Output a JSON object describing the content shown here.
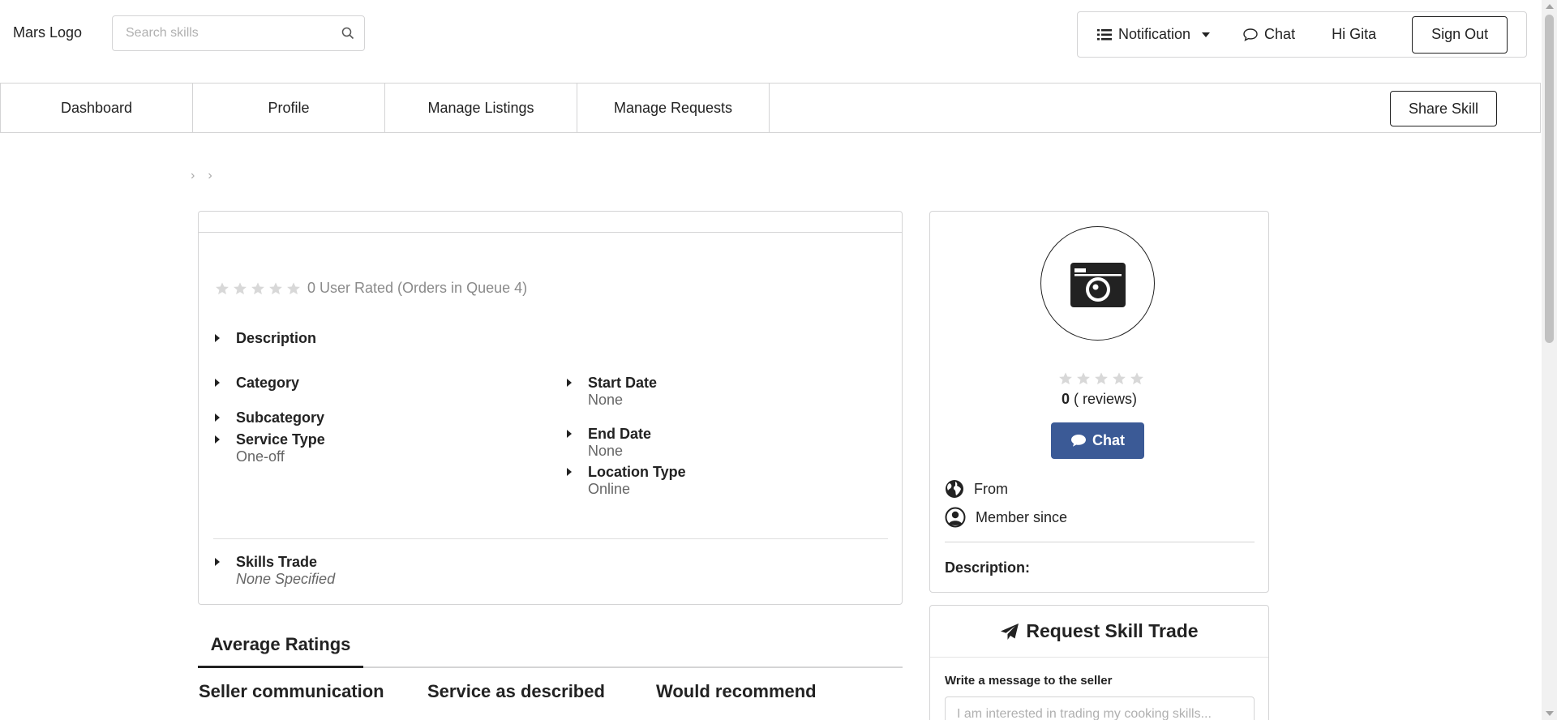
{
  "header": {
    "logo": "Mars Logo",
    "search_placeholder": "Search skills",
    "notification_label": "Notification",
    "chat_label": "Chat",
    "greeting": "Hi Gita",
    "signout_label": "Sign Out"
  },
  "nav": {
    "tabs": [
      {
        "label": "Dashboard"
      },
      {
        "label": "Profile"
      },
      {
        "label": "Manage Listings"
      },
      {
        "label": "Manage Requests"
      }
    ],
    "share_label": "Share Skill"
  },
  "breadcrumb": {
    "separators": [
      "›",
      "›"
    ]
  },
  "listing": {
    "rating_text": "0 User Rated (Orders in Queue 4)",
    "description_label": "Description",
    "category_label": "Category",
    "subcategory_label": "Subcategory",
    "service_type_label": "Service Type",
    "service_type_value": "One-off",
    "start_date_label": "Start Date",
    "start_date_value": "None",
    "end_date_label": "End Date",
    "end_date_value": "None",
    "location_type_label": "Location Type",
    "location_type_value": "Online",
    "skills_trade_label": "Skills Trade",
    "skills_trade_value": "None Specified"
  },
  "ratings": {
    "tab_label": "Average Ratings",
    "columns": [
      "Seller communication",
      "Service as described",
      "Would recommend"
    ]
  },
  "seller": {
    "review_count": "0",
    "review_suffix": "( reviews)",
    "chat_label": "Chat",
    "from_label": "From",
    "member_since_label": "Member since",
    "description_label": "Description:",
    "chat_color": "#3b5a96"
  },
  "request": {
    "title": "Request Skill Trade",
    "message_label": "Write a message to the seller",
    "message_placeholder": "I am interested in trading my cooking skills..."
  }
}
